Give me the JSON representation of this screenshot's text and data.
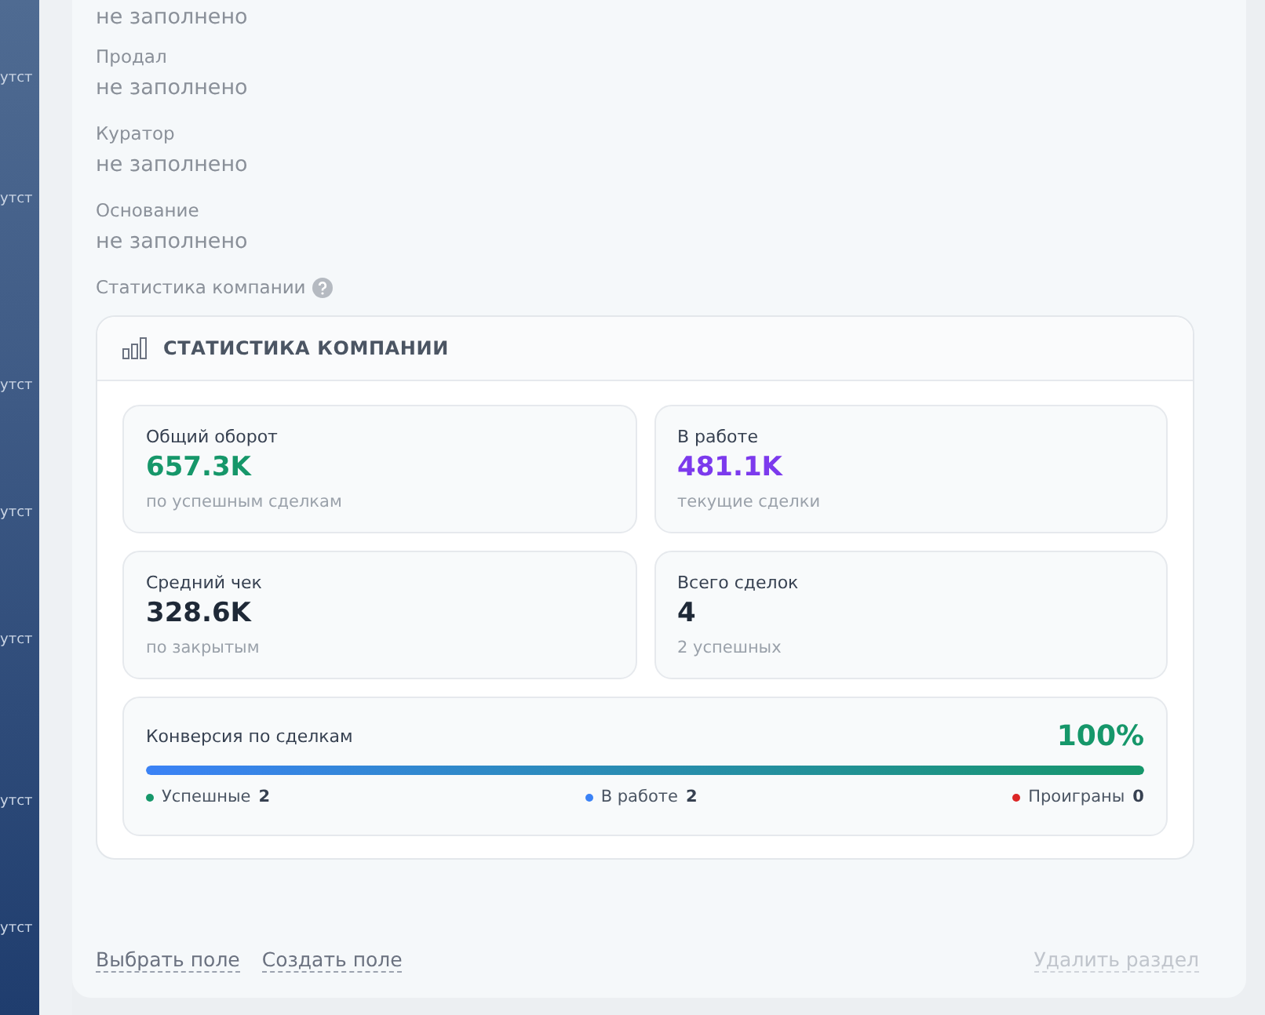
{
  "sidebar": {
    "items": [
      "утст",
      "утст",
      "утст",
      "утст",
      "утст",
      "утст",
      "утст"
    ]
  },
  "fields": [
    {
      "value": "не заполнено"
    },
    {
      "label": "Продал",
      "value": "не заполнено"
    },
    {
      "label": "Куратор",
      "value": "не заполнено"
    },
    {
      "label": "Основание",
      "value": "не заполнено"
    }
  ],
  "stats_label": "Статистика компании",
  "stats_card": {
    "title": "СТАТИСТИКА КОМПАНИИ",
    "tiles": [
      {
        "label": "Общий оборот",
        "value": "657.3K",
        "note": "по успешным сделкам",
        "color": "#16976a"
      },
      {
        "label": "В работе",
        "value": "481.1K",
        "note": "текущие сделки",
        "color": "#7c3aed"
      },
      {
        "label": "Средний чек",
        "value": "328.6K",
        "note": "по закрытым",
        "color": "#1f2937"
      },
      {
        "label": "Всего сделок",
        "value": "4",
        "note": "2 успешных",
        "color": "#1f2937"
      }
    ],
    "conversion": {
      "label": "Конверсия по сделкам",
      "percent": "100%",
      "level": 1,
      "legend": [
        {
          "label": "Успешные",
          "count": "2",
          "color": "#16976a"
        },
        {
          "label": "В работе",
          "count": "2",
          "color": "#3b82f6"
        },
        {
          "label": "Проиграны",
          "count": "0",
          "color": "#dc2626"
        }
      ]
    }
  },
  "footer": {
    "links": [
      {
        "label": "Выбрать поле",
        "disabled": false
      },
      {
        "label": "Создать поле",
        "disabled": false
      }
    ],
    "delete": {
      "label": "Удалить раздел",
      "disabled": true
    }
  }
}
